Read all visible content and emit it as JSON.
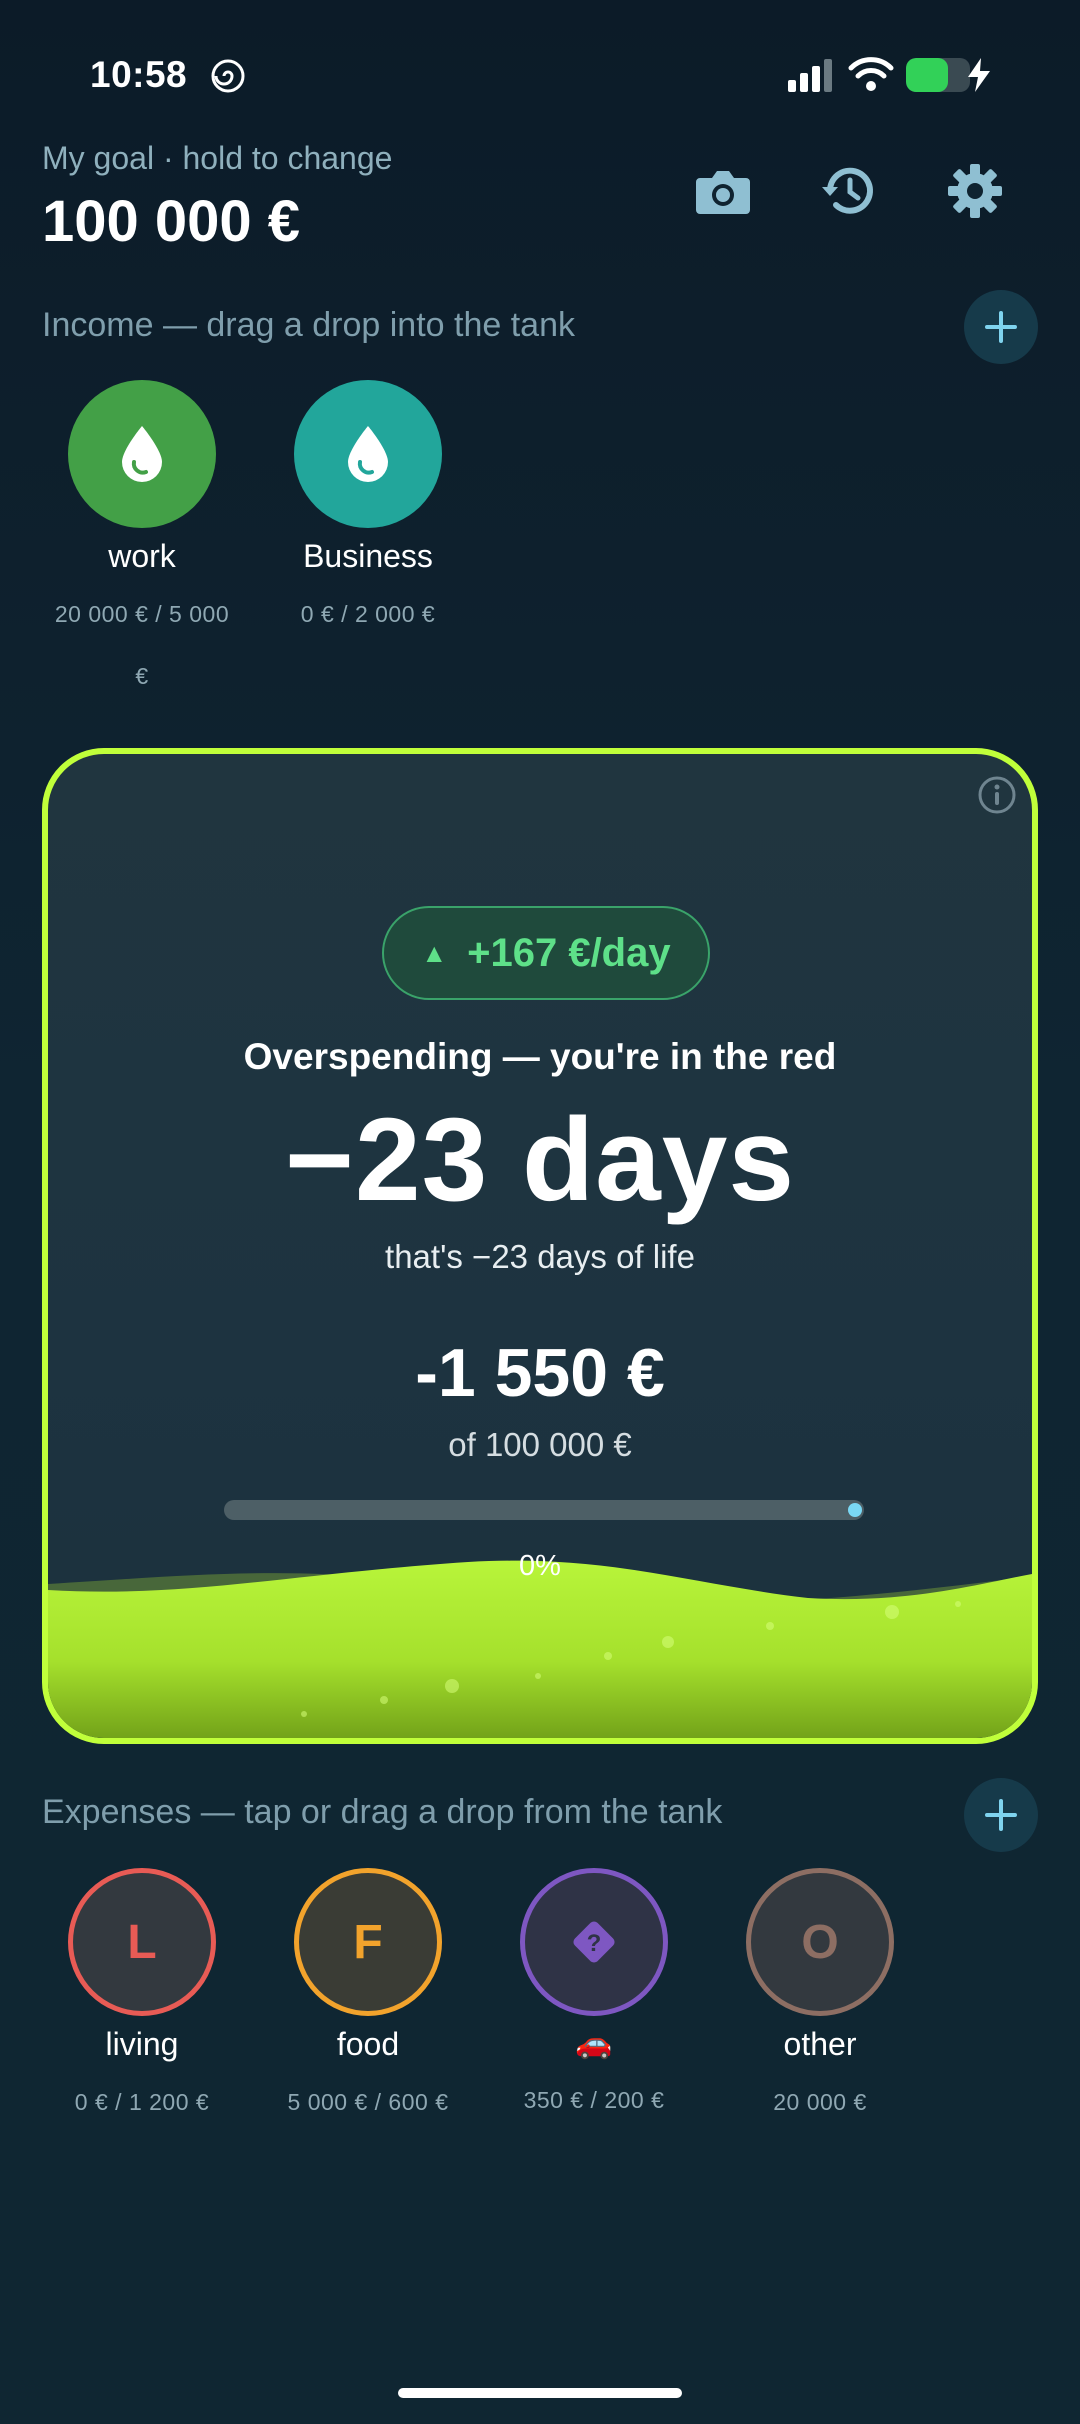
{
  "status_bar": {
    "time": "10:58",
    "battery_level": 0.66
  },
  "header": {
    "goal_label": "My goal · hold to change",
    "goal_value": "100 000 €",
    "icons": [
      "camera-icon",
      "history-icon",
      "gear-icon"
    ]
  },
  "income": {
    "title": "Income — drag a drop into the tank",
    "items": [
      {
        "name": "work",
        "amount_line1": "20 000 € / 5 000",
        "amount_line2": "€",
        "color": "#43a047",
        "icon": "drop-icon"
      },
      {
        "name": "Business",
        "amount_line1": "0 € / 2 000 €",
        "amount_line2": "",
        "color": "#22a69b",
        "icon": "drop-icon"
      }
    ]
  },
  "tank": {
    "rate_arrow": "▲",
    "rate": "+167 €/day",
    "status": "Overspending — you're in the red",
    "days": "−23 days",
    "days_sub": "that's −23 days of life",
    "balance": "-1 550 €",
    "of_total": "of 100 000 €",
    "progress_percent": 0,
    "progress_label": "0%",
    "accent": "#c0ff3a"
  },
  "expenses": {
    "title": "Expenses — tap or drag a drop from the tank",
    "items": [
      {
        "letter": "L",
        "name": "living",
        "amount": "0 € / 1 200 €",
        "color": "#e85b55"
      },
      {
        "letter": "F",
        "name": "food",
        "amount": "5 000 € / 600 €",
        "color": "#f2a32c"
      },
      {
        "letter": "",
        "name": "🚗",
        "amount": "350 € / 200 €",
        "color": "#7e57c2",
        "icon": "question-diamond-icon"
      },
      {
        "letter": "O",
        "name": "other",
        "amount": "20 000 €",
        "color": "#8d6e63"
      }
    ]
  }
}
